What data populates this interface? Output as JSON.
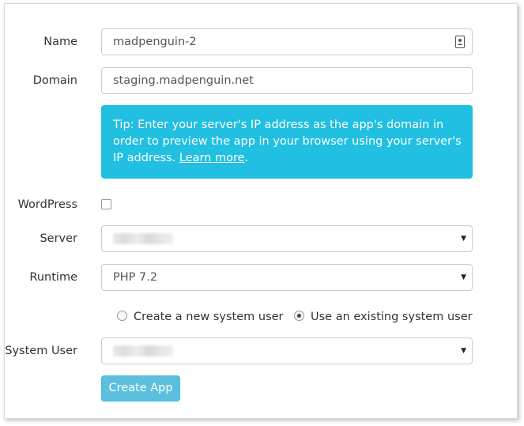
{
  "form": {
    "name": {
      "label": "Name",
      "value": "madpenguin-2"
    },
    "domain": {
      "label": "Domain",
      "value": "staging.madpenguin.net"
    },
    "tip": {
      "text": "Tip: Enter your server's IP address as the app's domain in order to preview the app in your browser using your server's IP address. ",
      "link": "Learn more",
      "end": ".",
      "background": "#21bfe1"
    },
    "wordpress": {
      "label": "WordPress",
      "checked": false
    },
    "server": {
      "label": "Server",
      "value": ""
    },
    "runtime": {
      "label": "Runtime",
      "value": "PHP 7.2"
    },
    "user_mode": {
      "options": [
        "Create a new system user",
        "Use an existing system user"
      ],
      "selected": "Use an existing system user"
    },
    "system_user": {
      "label": "System User",
      "value": ""
    },
    "submit_label": "Create App",
    "button_color": "#5bc0de"
  },
  "icons": {
    "name_field": "contact-card-icon",
    "select_caret": "caret-down-icon"
  }
}
